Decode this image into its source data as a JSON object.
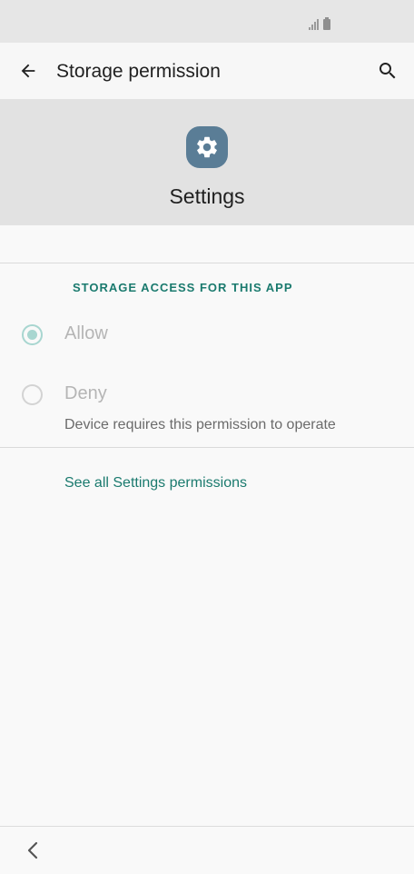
{
  "toolbar": {
    "title": "Storage permission",
    "back_icon": "arrow-back-icon",
    "search_icon": "search-icon"
  },
  "app": {
    "name": "Settings",
    "icon": "gear-icon",
    "icon_color": "#5a7d96"
  },
  "permission": {
    "section_header": "STORAGE ACCESS FOR THIS APP",
    "options": [
      {
        "label": "Allow",
        "selected": true
      },
      {
        "label": "Deny",
        "selected": false
      }
    ],
    "deny_summary": "Device requires this permission to operate"
  },
  "link": {
    "see_all": "See all Settings permissions"
  },
  "colors": {
    "accent": "#1a7a6e",
    "radio_checked": "#a8d6d0"
  }
}
